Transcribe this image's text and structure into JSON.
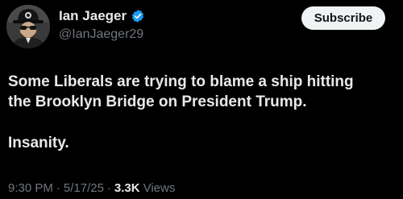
{
  "author": {
    "display_name": "Ian Jaeger",
    "handle": "@IanJaeger29",
    "avatar_icon": "profile-photo-icon",
    "verified_icon": "verified-badge-icon",
    "verified_color": "#1d9bf0"
  },
  "actions": {
    "subscribe_label": "Subscribe"
  },
  "post": {
    "lines": [
      "Some Liberals are trying to blame a ship hitting",
      "the Brooklyn Bridge on President Trump."
    ],
    "second_paragraph": "Insanity."
  },
  "meta": {
    "time": "9:30 PM",
    "separator": "·",
    "date": "5/17/25",
    "views_count": "3.3K",
    "views_label": "Views"
  },
  "colors": {
    "background": "#000000",
    "primary_text": "#e7e9ea",
    "secondary_text": "#71767b",
    "button_bg": "#eff3f4",
    "button_text": "#0f1419"
  }
}
